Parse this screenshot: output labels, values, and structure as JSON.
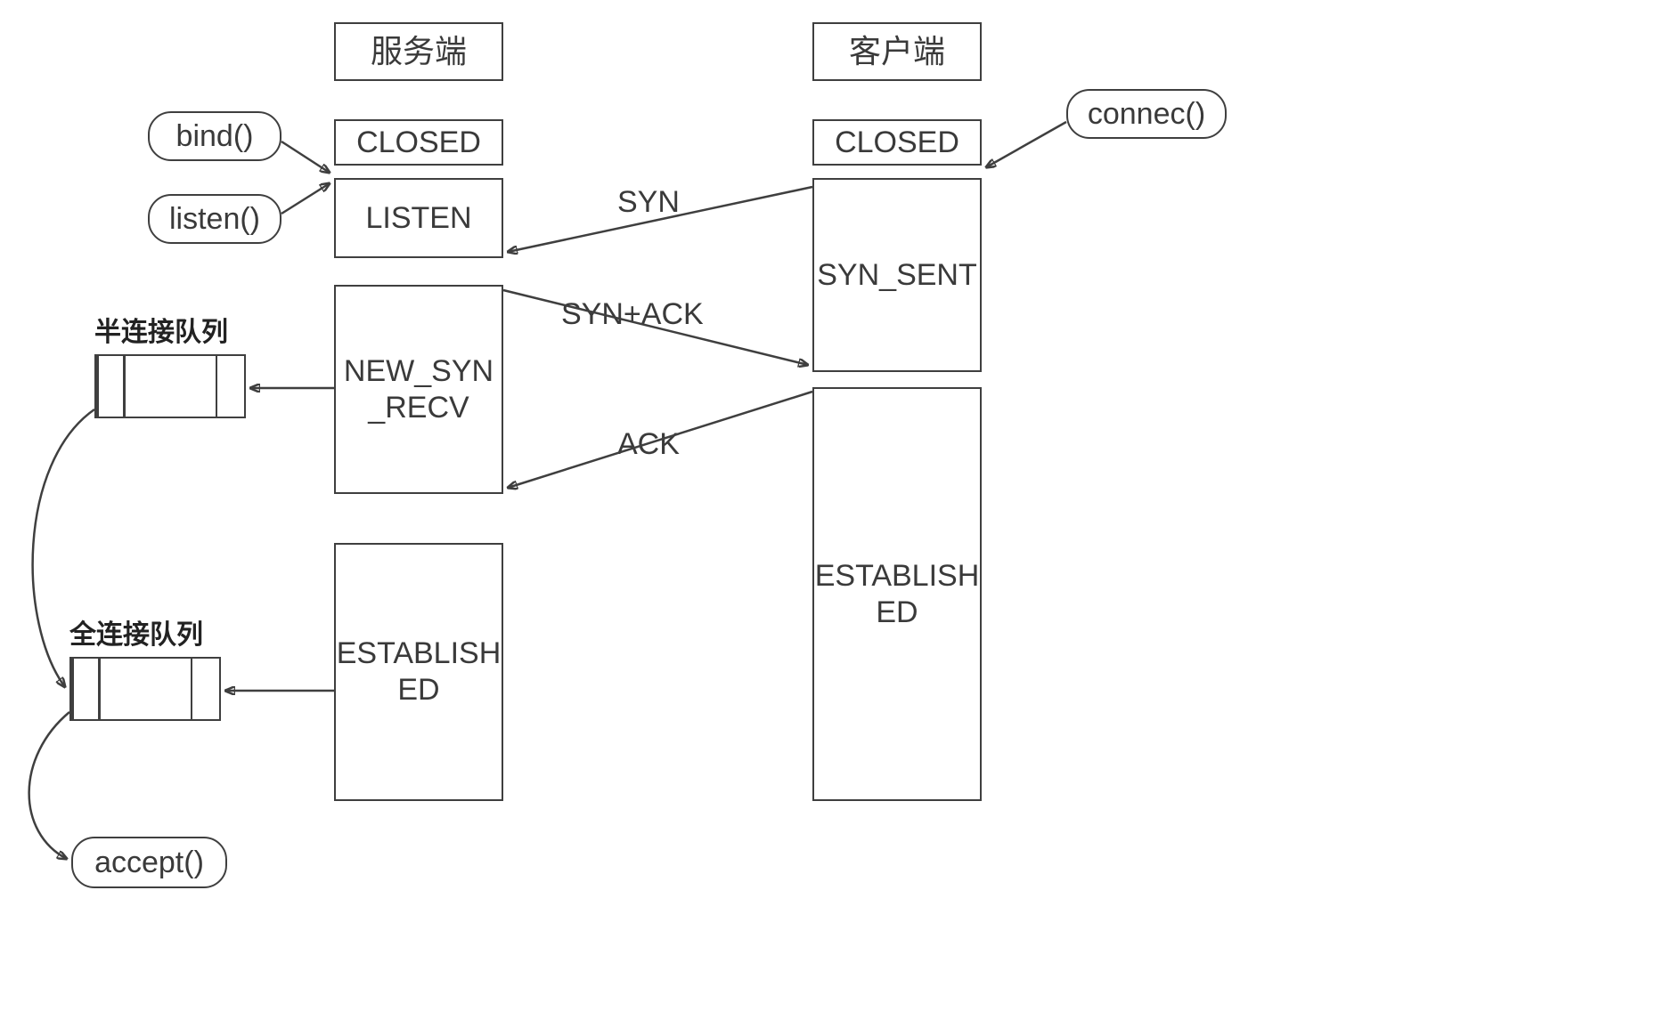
{
  "headers": {
    "server": "服务端",
    "client": "客户端"
  },
  "functions": {
    "bind": "bind()",
    "listen": "listen()",
    "connect": "connec()",
    "accept": "accept()"
  },
  "queues": {
    "half_label": "半连接队列",
    "full_label": "全连接队列"
  },
  "server_states": {
    "closed": "CLOSED",
    "listen": "LISTEN",
    "new_syn_recv": "NEW_SYN_RECV",
    "established": "ESTABLISHED"
  },
  "client_states": {
    "closed": "CLOSED",
    "syn_sent": "SYN_SENT",
    "established": "ESTABLISHED"
  },
  "messages": {
    "syn": "SYN",
    "syn_ack": "SYN+ACK",
    "ack": "ACK"
  }
}
